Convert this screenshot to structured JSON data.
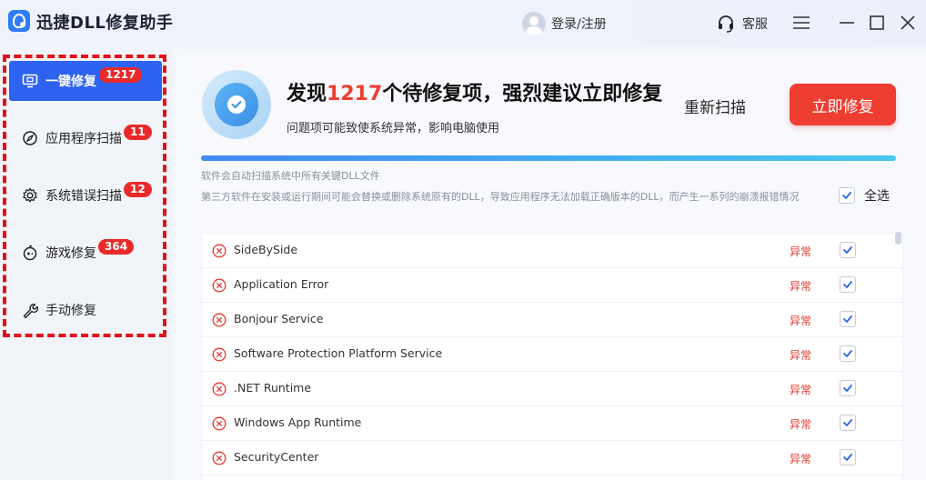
{
  "app": {
    "title": "迅捷DLL修复助手"
  },
  "header": {
    "login_label": "登录/注册",
    "service_label": "客服"
  },
  "sidebar": {
    "items": [
      {
        "label": "一键修复",
        "badge": "1217",
        "active": true,
        "icon": "monitor-icon"
      },
      {
        "label": "应用程序扫描",
        "badge": "11",
        "active": false,
        "icon": "compass-icon"
      },
      {
        "label": "系统错误扫描",
        "badge": "12",
        "active": false,
        "icon": "gear-icon"
      },
      {
        "label": "游戏修复",
        "badge": "364",
        "active": false,
        "icon": "gamepad-icon"
      },
      {
        "label": "手动修复",
        "badge": "",
        "active": false,
        "icon": "wrench-icon"
      }
    ]
  },
  "summary": {
    "headline_prefix": "发现",
    "headline_count": "1217",
    "headline_suffix": "个待修复项，强烈建议立即修复",
    "subline": "问题项可能致使系统异常，影响电脑使用",
    "rescan_label": "重新扫描",
    "fix_label": "立即修复",
    "progress_percent": 100
  },
  "info": {
    "line1": "软件会自动扫描系统中所有关键DLL文件",
    "line2": "第三方软件在安装或运行期间可能会替换或删除系统原有的DLL，导致应用程序无法加载正确版本的DLL，而产生一系列的崩溃报错情况",
    "select_all_label": "全选",
    "select_all_checked": true
  },
  "issues": [
    {
      "name": "SideBySide",
      "status": "异常",
      "checked": true
    },
    {
      "name": "Application Error",
      "status": "异常",
      "checked": true
    },
    {
      "name": "Bonjour Service",
      "status": "异常",
      "checked": true
    },
    {
      "name": "Software Protection Platform Service",
      "status": "异常",
      "checked": true
    },
    {
      "name": ".NET Runtime",
      "status": "异常",
      "checked": true
    },
    {
      "name": "Windows App Runtime",
      "status": "异常",
      "checked": true
    },
    {
      "name": "SecurityCenter",
      "status": "异常",
      "checked": true
    }
  ],
  "colors": {
    "accent": "#2d63f0",
    "danger": "#ee3e32",
    "highlight_box": "#e1121b"
  }
}
